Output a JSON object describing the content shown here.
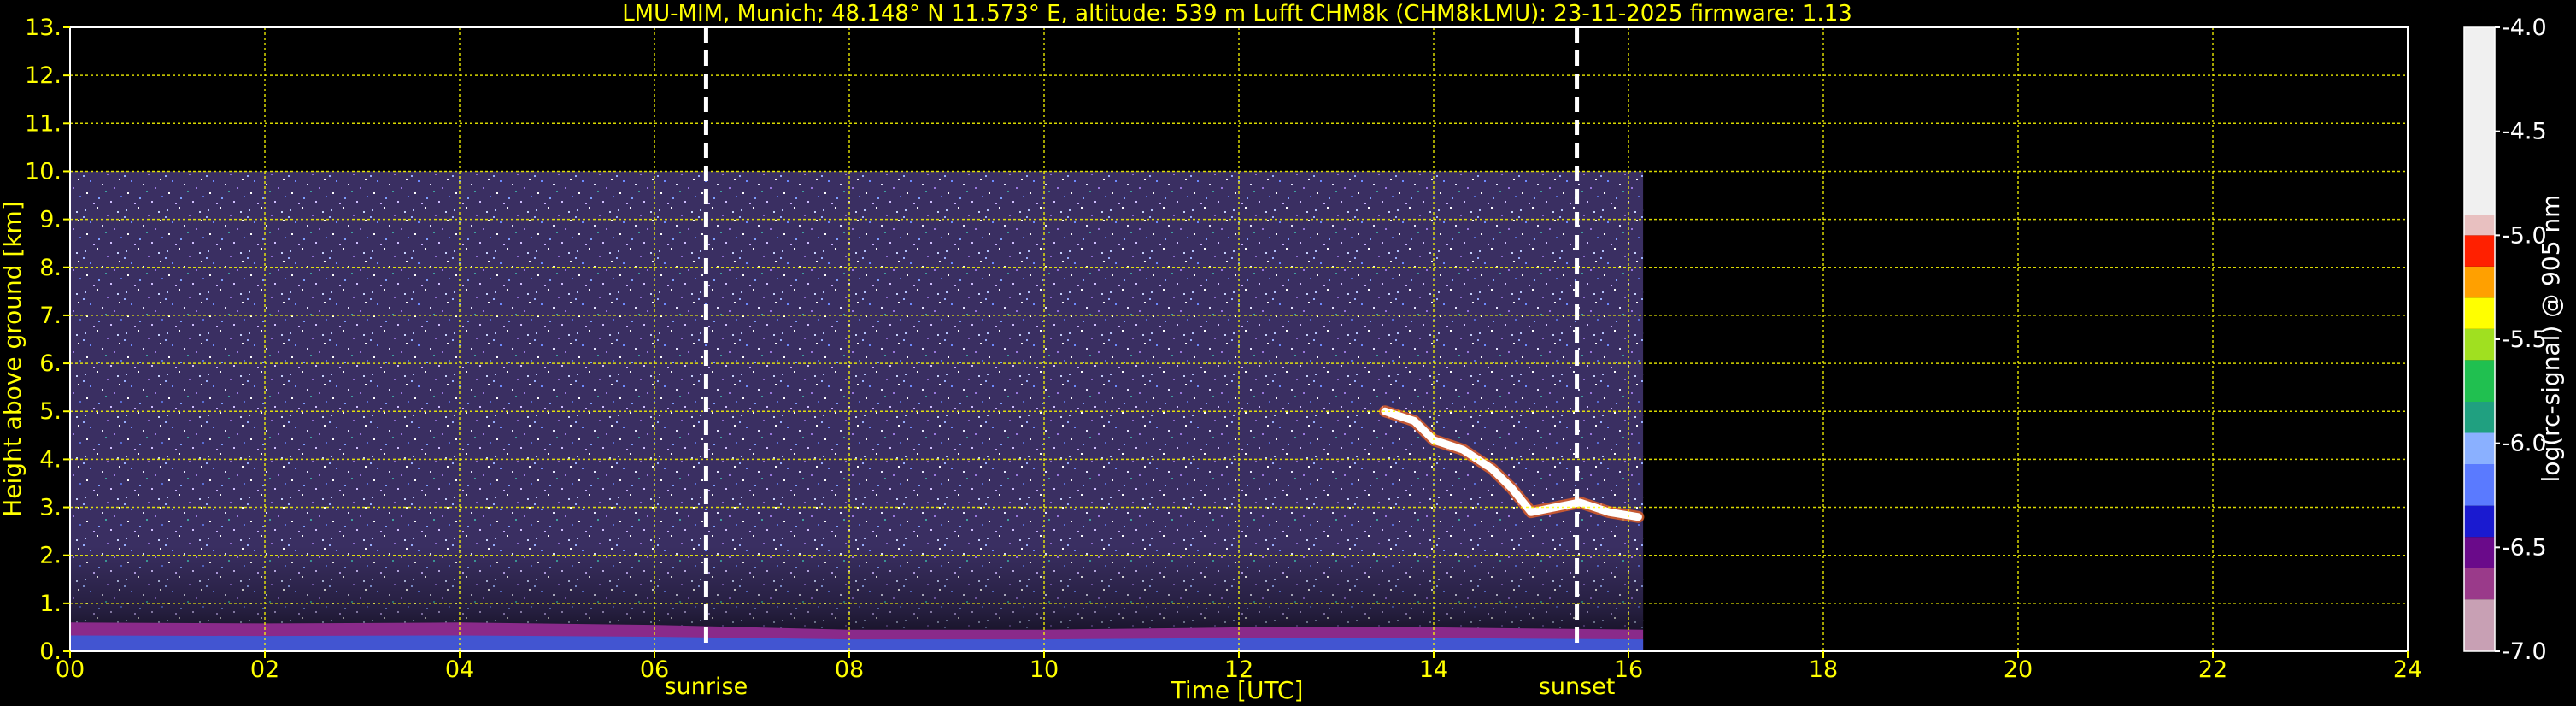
{
  "chart_data": {
    "type": "heatmap",
    "title": "LMU-MIM, Munich; 48.148° N 11.573° E, altitude: 539 m    Lufft CHM8k (CHM8kLMU): 23-11-2025    firmware: 1.13",
    "xlabel": "Time [UTC]",
    "ylabel": "Height above ground [km]",
    "xlim": [
      0,
      24
    ],
    "ylim": [
      0,
      13
    ],
    "x_ticks": [
      "00",
      "02",
      "04",
      "06",
      "08",
      "10",
      "12",
      "14",
      "16",
      "18",
      "20",
      "22",
      "24"
    ],
    "y_ticks": [
      "0.",
      "1.",
      "2.",
      "3.",
      "4.",
      "5.",
      "6.",
      "7.",
      "8.",
      "9.",
      "10.",
      "11.",
      "12.",
      "13."
    ],
    "grid": true,
    "data_coverage": {
      "time_start_h": 0,
      "time_end_h": 16.15,
      "max_height_km": 10
    },
    "events": [
      {
        "label": "sunrise",
        "time_h": 6.53
      },
      {
        "label": "sunset",
        "time_h": 15.47
      }
    ],
    "boundary_layer": [
      {
        "t": 0,
        "top_km": 0.6
      },
      {
        "t": 2,
        "top_km": 0.58
      },
      {
        "t": 4,
        "top_km": 0.6
      },
      {
        "t": 6,
        "top_km": 0.55
      },
      {
        "t": 8,
        "top_km": 0.45
      },
      {
        "t": 10,
        "top_km": 0.45
      },
      {
        "t": 12,
        "top_km": 0.5
      },
      {
        "t": 14,
        "top_km": 0.5
      },
      {
        "t": 16.15,
        "top_km": 0.45
      }
    ],
    "cloud_layer": [
      {
        "t": 13.5,
        "h_km": 5.0
      },
      {
        "t": 13.8,
        "h_km": 4.8
      },
      {
        "t": 14.0,
        "h_km": 4.4
      },
      {
        "t": 14.3,
        "h_km": 4.2
      },
      {
        "t": 14.6,
        "h_km": 3.8
      },
      {
        "t": 14.8,
        "h_km": 3.4
      },
      {
        "t": 15.0,
        "h_km": 2.9
      },
      {
        "t": 15.5,
        "h_km": 3.1
      },
      {
        "t": 15.8,
        "h_km": 2.9
      },
      {
        "t": 16.1,
        "h_km": 2.8
      }
    ],
    "colorbar": {
      "label": "log(rc-signal) @ 905 nm",
      "range": [
        -7.0,
        -4.0
      ],
      "ticks": [
        "-4.0",
        "-4.5",
        "-5.0",
        "-5.5",
        "-6.0",
        "-6.5",
        "-7.0"
      ],
      "stops": [
        {
          "v": -7.0,
          "color": "#c8a0b4"
        },
        {
          "v": -6.75,
          "color": "#9a3a8a"
        },
        {
          "v": -6.6,
          "color": "#6a0a8a"
        },
        {
          "v": -6.45,
          "color": "#1a1ad0"
        },
        {
          "v": -6.3,
          "color": "#5a7aff"
        },
        {
          "v": -6.1,
          "color": "#8ab0ff"
        },
        {
          "v": -5.95,
          "color": "#20a080"
        },
        {
          "v": -5.8,
          "color": "#20c050"
        },
        {
          "v": -5.6,
          "color": "#a0e020"
        },
        {
          "v": -5.45,
          "color": "#ffff00"
        },
        {
          "v": -5.3,
          "color": "#ffa000"
        },
        {
          "v": -5.15,
          "color": "#ff2000"
        },
        {
          "v": -5.0,
          "color": "#e8c0c0"
        },
        {
          "v": -4.9,
          "color": "#f0f0f0"
        },
        {
          "v": -4.0,
          "color": "#ffffff"
        }
      ]
    }
  }
}
